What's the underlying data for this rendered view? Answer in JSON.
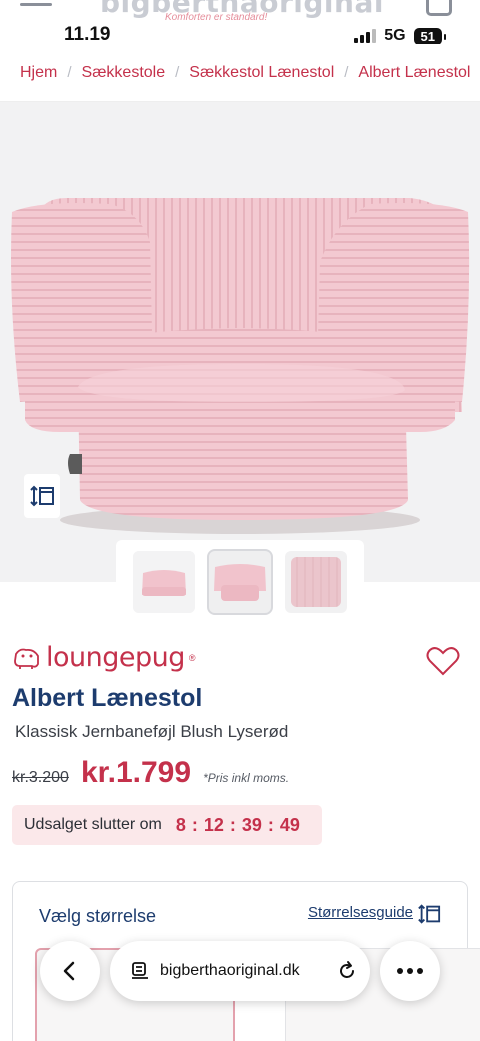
{
  "site": {
    "logo": "bigberthaoriginal",
    "tagline": "Komforten er standard!"
  },
  "status_bar": {
    "time": "11.19",
    "network": "5G",
    "battery": "51"
  },
  "breadcrumb": [
    {
      "label": "Hjem"
    },
    {
      "label": "Sækkestole"
    },
    {
      "label": "Sækkestol Lænestol"
    },
    {
      "label": "Albert Lænestol"
    }
  ],
  "product": {
    "brand": "loungepug",
    "brand_mark": "®",
    "title": "Albert Lænestol",
    "subtitle": "Klassisk Jernbaneføjl Blush Lyserød",
    "old_price": "kr.3.200",
    "price": "kr.1.799",
    "price_note": "*Pris inkl moms.",
    "sale_label": "Udsalget slutter om",
    "countdown": {
      "d": "8",
      "h": "12",
      "m": "39",
      "s": "49"
    },
    "colors": {
      "fabric": "#f2c7cf",
      "accent": "#c4314b",
      "navy": "#1d3c6e"
    }
  },
  "size_section": {
    "title": "Vælg størrelse",
    "guide_link": "Størrelsesguide"
  },
  "browser": {
    "url": "bigberthaoriginal.dk",
    "back_icon": "chevron-left-icon",
    "reader_icon": "reader-icon",
    "reload_icon": "reload-icon",
    "more_icon": "more-icon"
  }
}
